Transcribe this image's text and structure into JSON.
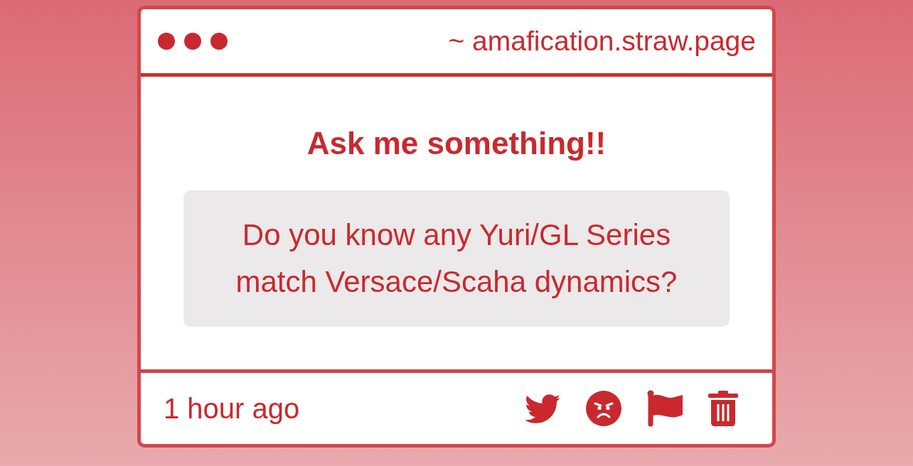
{
  "window": {
    "address": "~ amafication.straw.page"
  },
  "prompt": {
    "title": "Ask me something!!",
    "question": "Do you know any Yuri/GL Series match Versace/Scaha dynamics?"
  },
  "footer": {
    "time": "1 hour ago"
  }
}
